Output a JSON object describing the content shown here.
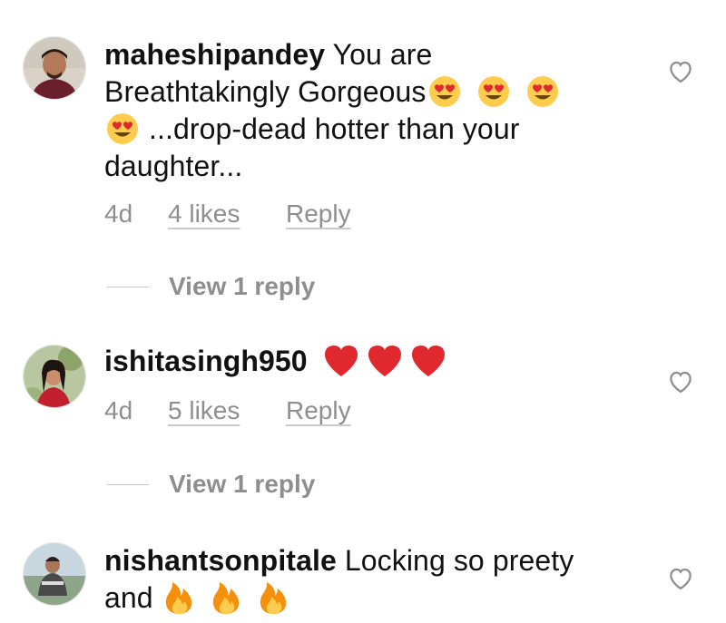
{
  "comments": [
    {
      "username": "maheshipandey",
      "text_1": " You are",
      "text_2": "Breathtakingly Gorgeous",
      "text_3": " ...drop-dead hotter than your",
      "text_4": "daughter...",
      "time": "4d",
      "likes": "4 likes",
      "reply": "Reply",
      "view_replies": "View 1 reply",
      "emoji": "heart-eyes-emoji"
    },
    {
      "username": "ishitasingh950",
      "time": "4d",
      "likes": "5 likes",
      "reply": "Reply",
      "view_replies": "View 1 reply",
      "emoji": "red-heart-emoji"
    },
    {
      "username": "nishantsonpitale",
      "text_1": " Locking so preety",
      "text_2": "and ",
      "emoji": "fire-emoji"
    }
  ],
  "colors": {
    "text": "#111111",
    "meta": "#8e8e8e",
    "heart_red": "#e0292f",
    "fire": "#f4900c"
  },
  "icons": {
    "like": "heart-outline-icon"
  }
}
